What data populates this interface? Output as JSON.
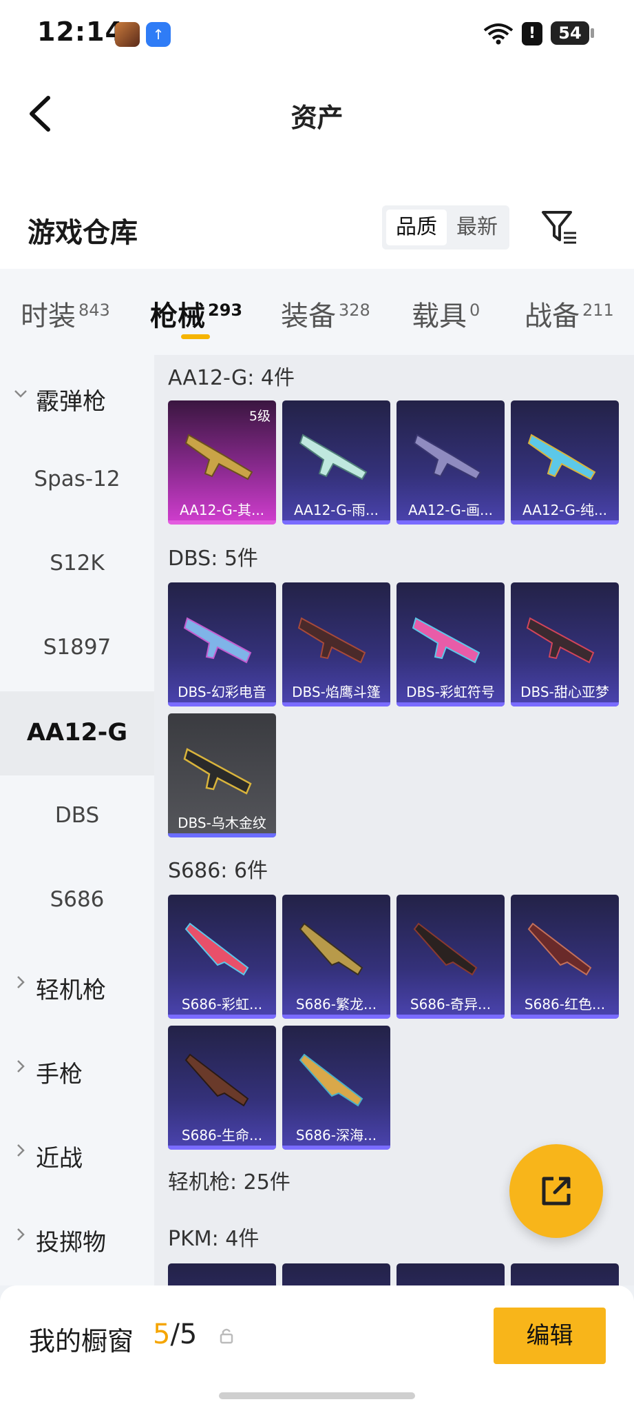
{
  "status_bar": {
    "time": "12:14",
    "battery": "54",
    "icons": [
      "game-app-icon",
      "upload-app-icon",
      "wifi-icon",
      "alert-icon",
      "battery-icon"
    ]
  },
  "header": {
    "title": "资产"
  },
  "section": {
    "title": "游戏仓库",
    "sort_options": [
      "品质",
      "最新"
    ],
    "active_sort": "品质"
  },
  "tabs": [
    {
      "label": "时装",
      "count": "843"
    },
    {
      "label": "枪械",
      "count": "293"
    },
    {
      "label": "装备",
      "count": "328"
    },
    {
      "label": "载具",
      "count": "0"
    },
    {
      "label": "战备",
      "count": "211"
    }
  ],
  "active_tab": "枪械",
  "sidebar": {
    "group_shotgun": "霰弹枪",
    "sub_items": [
      "Spas-12",
      "S12K",
      "S1897",
      "AA12-G",
      "DBS",
      "S686"
    ],
    "active_item": "AA12-G",
    "group_lmg": "轻机枪",
    "group_pistol": "手枪",
    "group_melee": "近战",
    "group_throwable": "投掷物"
  },
  "groups": [
    {
      "title": "AA12-G: 4件",
      "items": [
        "AA12-G-其...",
        "AA12-G-雨...",
        "AA12-G-画...",
        "AA12-G-纯..."
      ],
      "first_level_badge": "5级"
    },
    {
      "title": "DBS: 5件",
      "items": [
        "DBS-幻彩电音",
        "DBS-焰鹰斗篷",
        "DBS-彩虹符号",
        "DBS-甜心亚梦",
        "DBS-乌木金纹"
      ]
    },
    {
      "title": "S686: 6件",
      "items": [
        "S686-彩虹...",
        "S686-繁龙...",
        "S686-奇异...",
        "S686-红色...",
        "S686-生命...",
        "S686-深海..."
      ]
    },
    {
      "title": "轻机枪: 25件"
    },
    {
      "title": "PKM: 4件"
    }
  ],
  "bottom_bar": {
    "label": "我的橱窗",
    "current": "5",
    "total": "/5",
    "edit_label": "编辑"
  },
  "colors": {
    "accent": "#f8b51a",
    "card_blue": "#34317a",
    "card_purple": "#d23ed0"
  }
}
